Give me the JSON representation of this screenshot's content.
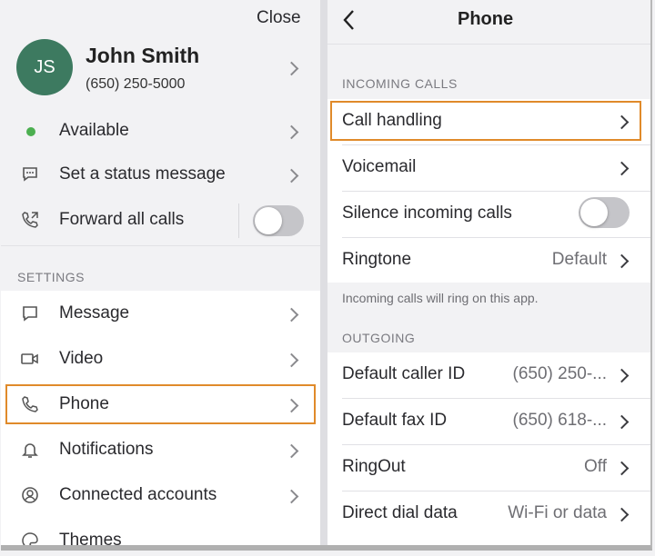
{
  "left": {
    "close_label": "Close",
    "profile": {
      "initials": "JS",
      "name": "John Smith",
      "phone": "(650) 250-5000",
      "avatar_color": "#3d7a60"
    },
    "status_items": [
      {
        "label": "Available",
        "icon": "green-dot-icon"
      },
      {
        "label": "Set a status message",
        "icon": "message-status-icon"
      },
      {
        "label": "Forward all calls",
        "icon": "forward-call-icon",
        "toggle": false
      }
    ],
    "settings_header": "SETTINGS",
    "settings_items": [
      {
        "label": "Message",
        "icon": "message-icon"
      },
      {
        "label": "Video",
        "icon": "video-icon"
      },
      {
        "label": "Phone",
        "icon": "phone-icon",
        "highlighted": true
      },
      {
        "label": "Notifications",
        "icon": "bell-icon"
      },
      {
        "label": "Connected accounts",
        "icon": "account-icon"
      },
      {
        "label": "Themes",
        "icon": "palette-icon"
      }
    ]
  },
  "right": {
    "title": "Phone",
    "incoming_header": "INCOMING CALLS",
    "incoming_items": [
      {
        "label": "Call handling",
        "highlighted": true
      },
      {
        "label": "Voicemail"
      },
      {
        "label": "Silence incoming calls",
        "toggle": false
      },
      {
        "label": "Ringtone",
        "value": "Default"
      }
    ],
    "incoming_note": "Incoming calls will ring on this app.",
    "outgoing_header": "OUTGOING",
    "outgoing_items": [
      {
        "label": "Default caller ID",
        "value": "(650) 250-..."
      },
      {
        "label": "Default fax ID",
        "value": "(650) 618-..."
      },
      {
        "label": "RingOut",
        "value": "Off"
      },
      {
        "label": "Direct dial data",
        "value": "Wi-Fi or data"
      }
    ]
  },
  "colors": {
    "highlight": "#e08a2a",
    "available": "#4caf50"
  }
}
